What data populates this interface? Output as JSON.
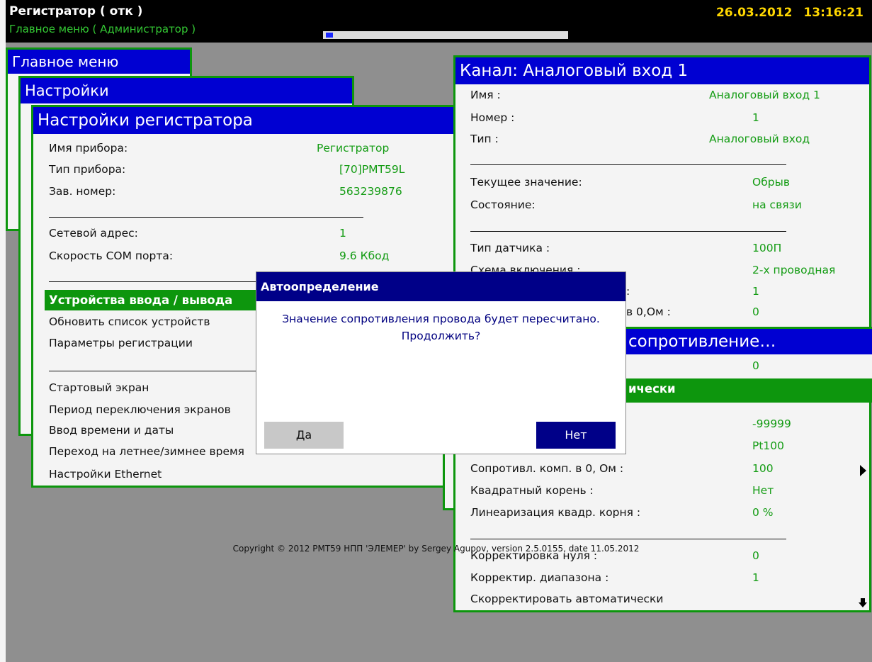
{
  "header": {
    "title": "Регистратор ( отк )",
    "subtitle": "Главное меню ( Администратор )",
    "progress_fraction": 0.03,
    "date": "26.03.2012",
    "time": "13:16:21"
  },
  "windows": {
    "main_menu": {
      "title": "Главное меню"
    },
    "settings": {
      "title": "Настройки"
    },
    "recorder_settings": {
      "title": "Настройки регистратора",
      "device_name_label": "Имя прибора:",
      "device_name_value": "Регистратор",
      "device_type_label": "Тип прибора:",
      "device_type_value": "[70]PMT59L",
      "serial_label": "Зав. номер:",
      "serial_value": "563239876",
      "net_address_label": "Сетевой адрес:",
      "net_address_value": "1",
      "com_speed_label": "Скорость COM порта:",
      "com_speed_value": "9.6 Кбод",
      "io_devices": "Устройства ввода / вывода",
      "refresh_devices": "Обновить список устройств",
      "registration_params": "Параметры регистрации",
      "start_screen": "Стартовый экран",
      "screen_period": "Период переключения экранов",
      "datetime_input": "Ввод времени и даты",
      "dst_switch": "Переход на летнее/зимнее время",
      "ethernet_settings": "Настройки Ethernet"
    },
    "channel": {
      "title": "Канал: Аналоговый вход 1",
      "name_label": "Имя :",
      "name_value": "Аналоговый вход 1",
      "number_label": "Номер :",
      "number_value": "1",
      "type_label": "Тип :",
      "type_value": "Аналоговый вход",
      "current_label": "Текущее значение:",
      "current_value": "Обрыв",
      "state_label": "Состояние:",
      "state_value": "на связи",
      "sensor_type_label": "Тип датчика :",
      "sensor_type_value": "100П",
      "wiring_label": "Схема включения :",
      "wiring_value": "2-х проводная",
      "hidden1_label": ":",
      "hidden1_value": "1",
      "hidden2_label": "в 0,Ом :",
      "hidden2_value": "0",
      "val_99999_partial": "99999",
      "val_neg_99999": "-99999",
      "val_pt100": "Pt100",
      "comp_resist_label": "Сопротивл. комп. в 0, Ом :",
      "comp_resist_value": "100",
      "sqrt_label": "Квадратный корень :",
      "sqrt_value": "Нет",
      "sqrt_lin_label": "Линеаризация квадр. корня :",
      "sqrt_lin_value": "0 %",
      "zero_corr_label": "Корректировка нуля :",
      "zero_corr_value": "0",
      "range_corr_label": "Корректир. диапазона :",
      "range_corr_value": "1",
      "auto_corr": "Скорректировать автоматически"
    },
    "resist_sub": {
      "title": "сопротивление…",
      "value": "0",
      "highlight": "ически"
    }
  },
  "dialog": {
    "title": "Автоопределение",
    "message_line1": "Значение сопротивления провода будет пересчитано.",
    "message_line2": "Продолжить?",
    "yes": "Да",
    "no": "Нет"
  },
  "footer": {
    "copyright": "Copyright © 2012 PMT59 НПП 'ЭЛЕМЕР' by Sergey Agupov, version 2.5.0155, date 11.05.2012"
  },
  "colors": {
    "title_bar": "#0000d2",
    "frame": "#0d960d",
    "value_text": "#149c14",
    "dialog_title": "#000088",
    "date_text": "#ffd700"
  }
}
